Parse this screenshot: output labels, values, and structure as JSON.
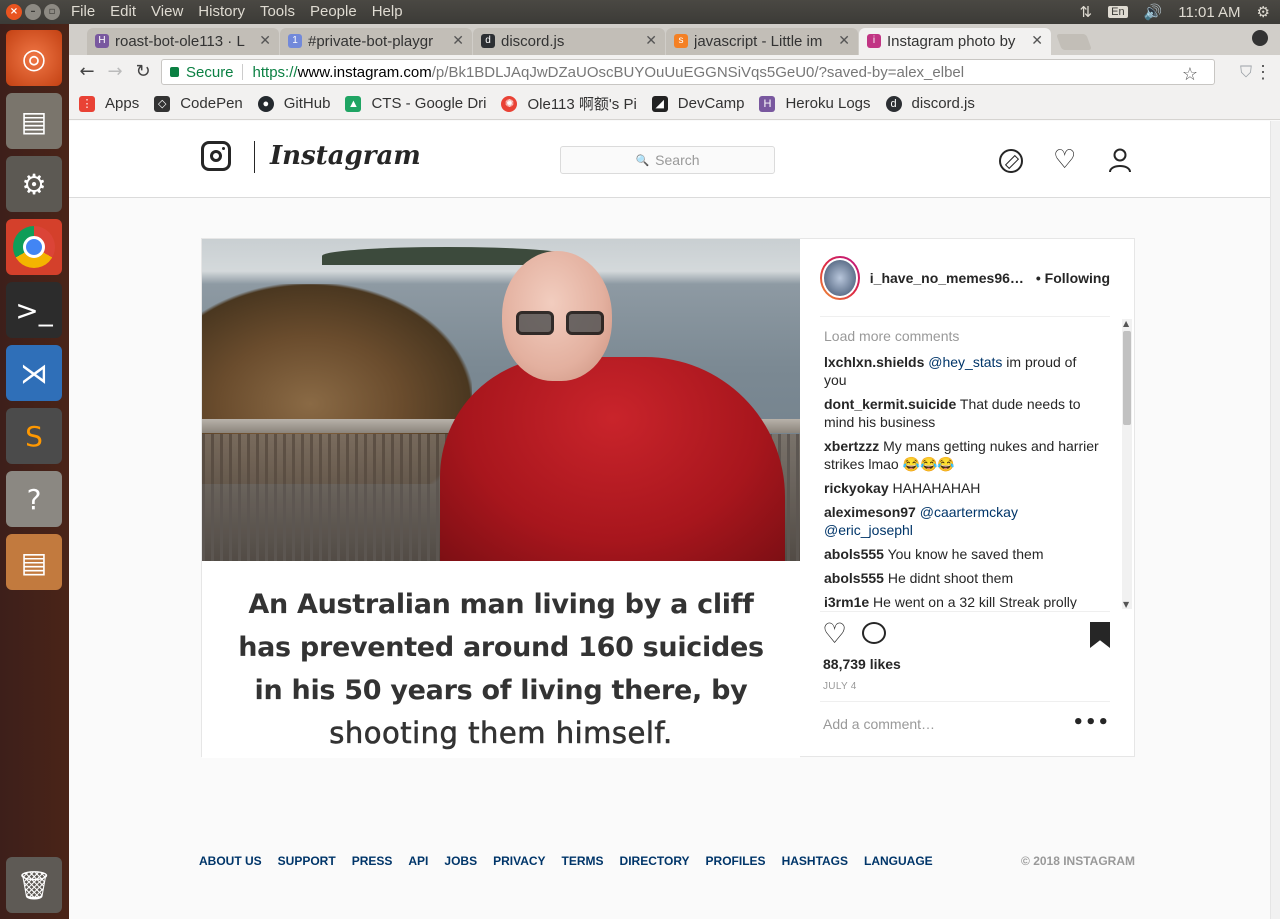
{
  "desktop": {
    "menus": [
      "File",
      "Edit",
      "View",
      "History",
      "Tools",
      "People",
      "Help"
    ],
    "lang": "En",
    "clock": "11:01 AM"
  },
  "tabs": [
    {
      "title": "roast-bot-ole113 · L",
      "icon_color": "#79589f",
      "icon": "H"
    },
    {
      "title": "#private-bot-playgr",
      "icon_color": "#7289da",
      "icon": "1"
    },
    {
      "title": "discord.js",
      "icon_color": "#2c2f33",
      "icon": "d"
    },
    {
      "title": "javascript - Little im",
      "icon_color": "#f48024",
      "icon": "s"
    },
    {
      "title": "Instagram photo by",
      "icon_color": "#c13584",
      "icon": "i"
    }
  ],
  "address": {
    "secure_label": "Secure",
    "scheme": "https://",
    "host": "www.instagram.com",
    "path": "/p/Bk1BDLJAqJwDZaUOscBUYOuUuEGGNSiVqs5GeU0/?saved-by=alex_elbel"
  },
  "bookmarks": [
    {
      "label": "Apps",
      "color": "#e94235"
    },
    {
      "label": "CodePen",
      "color": "#333333"
    },
    {
      "label": "GitHub",
      "color": "#24292e"
    },
    {
      "label": "CTS - Google Dri",
      "color": "#1fa463"
    },
    {
      "label": "Ole113 啊额's Pi",
      "color": "#e94235"
    },
    {
      "label": "DevCamp",
      "color": "#222222"
    },
    {
      "label": "Heroku Logs",
      "color": "#79589f"
    },
    {
      "label": "discord.js",
      "color": "#2c2f33"
    }
  ],
  "ig": {
    "wordmark": "Instagram",
    "search_placeholder": "Search",
    "post": {
      "username": "i_have_no_memes96…",
      "follow_label": "• Following",
      "image_caption_lines": [
        "An Australian man living by a cliff",
        "has prevented around 160 suicides",
        "in his 50 years of living there, by",
        "shooting them himself."
      ],
      "load_more": "Load more comments",
      "comments": [
        {
          "user": "lxchlxn.shields",
          "mention": "@hey_stats",
          "text": " im proud of you"
        },
        {
          "user": "dont_kermit.suicide",
          "mention": "",
          "text": " That dude needs to mind his business"
        },
        {
          "user": "xbertzzz",
          "mention": "",
          "text": " My mans getting nukes and harrier strikes lmao 😂😂😂"
        },
        {
          "user": "rickyokay",
          "mention": "",
          "text": " HAHAHAHAH"
        },
        {
          "user": "aleximeson97",
          "mention": "@caartermckay @eric_josephl",
          "text": ""
        },
        {
          "user": "abols555",
          "mention": "",
          "text": " You know he saved them"
        },
        {
          "user": "abols555",
          "mention": "",
          "text": " He didnt shoot them"
        },
        {
          "user": "i3rm1e",
          "mention": "",
          "text": " He went on a 32 kill Streak prolly"
        }
      ],
      "likes": "88,739 likes",
      "date": "JULY 4",
      "add_comment_placeholder": "Add a comment…",
      "more": "•••"
    },
    "footer": {
      "links": [
        "ABOUT US",
        "SUPPORT",
        "PRESS",
        "API",
        "JOBS",
        "PRIVACY",
        "TERMS",
        "DIRECTORY",
        "PROFILES",
        "HASHTAGS",
        "LANGUAGE"
      ],
      "copyright": "© 2018 INSTAGRAM"
    }
  }
}
